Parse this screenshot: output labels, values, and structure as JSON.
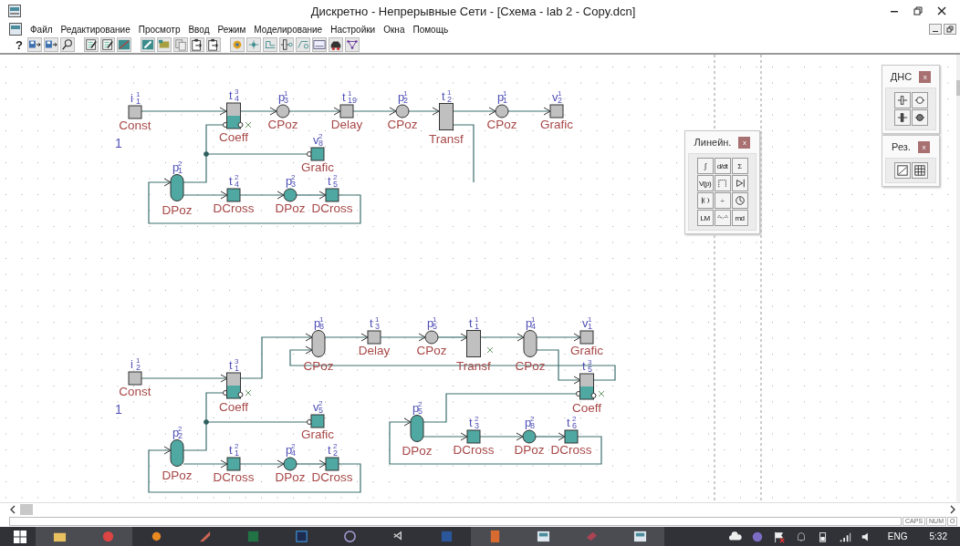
{
  "window": {
    "title": "Дискретно - Непрерывные Сети - [Схема - lab 2 - Copy.dcn]"
  },
  "menu": [
    "Файл",
    "Редактирование",
    "Просмотр",
    "Ввод",
    "Режим",
    "Моделирование",
    "Настройки",
    "Окна",
    "Помощь"
  ],
  "toolbar": {
    "help": "?"
  },
  "diagram": {
    "nodes": [
      {
        "kind": "square",
        "color": "#c0c0c0",
        "letter": "i",
        "sub": "1",
        "sup": "1",
        "label": "Const",
        "value": "1"
      },
      {
        "kind": "coeff",
        "letter": "t",
        "sub": "4",
        "sup": "3",
        "label": "Coeff"
      },
      {
        "kind": "circle",
        "color": "#c0c0c0",
        "letter": "p",
        "sub": "3",
        "sup": "1",
        "label": "CPoz"
      },
      {
        "kind": "square",
        "color": "#c0c0c0",
        "letter": "t",
        "sub": "19",
        "sup": "1",
        "label": "Delay"
      },
      {
        "kind": "circle",
        "color": "#c0c0c0",
        "letter": "p",
        "sub": "2",
        "sup": "1",
        "label": "CPoz"
      },
      {
        "kind": "bar",
        "color": "#c0c0c0",
        "letter": "t",
        "sub": "2",
        "sup": "1",
        "label": "Transf"
      },
      {
        "kind": "circle",
        "color": "#c0c0c0",
        "letter": "p",
        "sub": "1",
        "sup": "1",
        "label": "CPoz"
      },
      {
        "kind": "square",
        "color": "#c0c0c0",
        "letter": "v",
        "sub": "2",
        "sup": "1",
        "label": "Grafic"
      },
      {
        "kind": "square",
        "color": "#4fa8a2",
        "letter": "v",
        "sub": "8",
        "sup": "2",
        "label": "Grafic"
      },
      {
        "kind": "oval",
        "color": "#4fa8a2",
        "letter": "p",
        "sub": "1",
        "sup": "2",
        "label": "DPoz"
      },
      {
        "kind": "square",
        "color": "#4fa8a2",
        "letter": "t",
        "sub": "4",
        "sup": "2",
        "label": "DCross"
      },
      {
        "kind": "circle",
        "color": "#4fa8a2",
        "letter": "p",
        "sub": "3",
        "sup": "2",
        "label": "DPoz"
      },
      {
        "kind": "square",
        "color": "#4fa8a2",
        "letter": "t",
        "sub": "5",
        "sup": "2",
        "label": "DCross"
      },
      {
        "kind": "square",
        "color": "#c0c0c0",
        "letter": "i",
        "sub": "2",
        "sup": "1",
        "label": "Const",
        "value": "1"
      },
      {
        "kind": "coeff",
        "letter": "t",
        "sub": "1",
        "sup": "3",
        "label": "Coeff"
      },
      {
        "kind": "oval",
        "color": "#c0c0c0",
        "letter": "p",
        "sub": "8",
        "sup": "1",
        "label": "CPoz"
      },
      {
        "kind": "square",
        "color": "#c0c0c0",
        "letter": "t",
        "sub": "3",
        "sup": "1",
        "label": "Delay"
      },
      {
        "kind": "circle",
        "color": "#c0c0c0",
        "letter": "p",
        "sub": "5",
        "sup": "1",
        "label": "CPoz"
      },
      {
        "kind": "bar",
        "color": "#c0c0c0",
        "letter": "t",
        "sub": "1",
        "sup": "1",
        "label": "Transf"
      },
      {
        "kind": "oval",
        "color": "#c0c0c0",
        "letter": "p",
        "sub": "4",
        "sup": "1",
        "label": "CPoz"
      },
      {
        "kind": "square",
        "color": "#c0c0c0",
        "letter": "v",
        "sub": "1",
        "sup": "1",
        "label": "Grafic"
      },
      {
        "kind": "coeff",
        "letter": "t",
        "sub": "5",
        "sup": "3",
        "label": "Coeff"
      },
      {
        "kind": "square",
        "color": "#4fa8a2",
        "letter": "v",
        "sub": "5",
        "sup": "2",
        "label": "Grafic"
      },
      {
        "kind": "oval",
        "color": "#4fa8a2",
        "letter": "p",
        "sub": "2",
        "sup": "2",
        "label": "DPoz"
      },
      {
        "kind": "square",
        "color": "#4fa8a2",
        "letter": "t",
        "sub": "1",
        "sup": "2",
        "label": "DCross"
      },
      {
        "kind": "circle",
        "color": "#4fa8a2",
        "letter": "p",
        "sub": "4",
        "sup": "2",
        "label": "DPoz"
      },
      {
        "kind": "square",
        "color": "#4fa8a2",
        "letter": "t",
        "sub": "2",
        "sup": "2",
        "label": "DCross"
      },
      {
        "kind": "oval",
        "color": "#4fa8a2",
        "letter": "p",
        "sub": "5",
        "sup": "2",
        "label": "DPoz"
      },
      {
        "kind": "square",
        "color": "#4fa8a2",
        "letter": "t",
        "sub": "3",
        "sup": "2",
        "label": "DCross"
      },
      {
        "kind": "circle",
        "color": "#4fa8a2",
        "letter": "p",
        "sub": "8",
        "sup": "2",
        "label": "DPoz"
      },
      {
        "kind": "square",
        "color": "#4fa8a2",
        "letter": "t",
        "sub": "6",
        "sup": "2",
        "label": "DCross"
      }
    ]
  },
  "palettes": [
    {
      "title": "Линейн.",
      "close": "x",
      "buttons": [
        {
          "kind": "text",
          "label": "∫"
        },
        {
          "kind": "text",
          "label": "d/dt"
        },
        {
          "kind": "text",
          "label": "Σ"
        },
        {
          "kind": "text",
          "label": "V(p)"
        },
        {
          "kind": "icon"
        },
        {
          "kind": "icon"
        },
        {
          "kind": "icon"
        },
        {
          "kind": "text",
          "label": "÷"
        },
        {
          "kind": "icon"
        },
        {
          "kind": "text",
          "label": "LM"
        },
        {
          "kind": "icon"
        },
        {
          "kind": "text",
          "label": "md"
        }
      ]
    },
    {
      "title": "ДНС",
      "close": "x",
      "buttons": [
        {
          "kind": "icon"
        },
        {
          "kind": "icon"
        },
        {
          "kind": "icon"
        },
        {
          "kind": "icon"
        }
      ]
    },
    {
      "title": "Рез.",
      "close": "x",
      "buttons": [
        {
          "kind": "icon"
        },
        {
          "kind": "icon"
        }
      ]
    }
  ],
  "status_bar": [
    "CAPS",
    "NUM",
    "O"
  ],
  "taskbar": {
    "language": "ENG",
    "time": "5:32"
  }
}
